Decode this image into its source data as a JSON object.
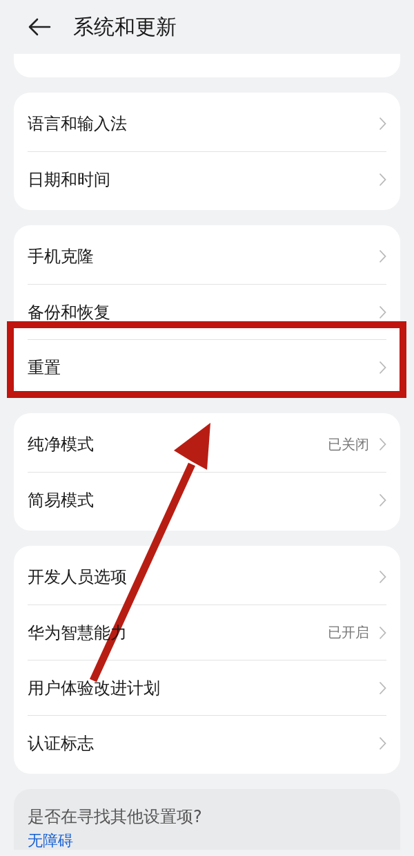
{
  "header": {
    "title": "系统和更新"
  },
  "groups": [
    {
      "items": [
        {
          "label": "语言和输入法",
          "highlighted": false
        },
        {
          "label": "日期和时间",
          "highlighted": false
        }
      ]
    },
    {
      "items": [
        {
          "label": "手机克隆",
          "highlighted": false
        },
        {
          "label": "备份和恢复",
          "highlighted": false
        },
        {
          "label": "重置",
          "highlighted": true
        }
      ]
    },
    {
      "items": [
        {
          "label": "纯净模式",
          "value": "已关闭",
          "highlighted": false
        },
        {
          "label": "简易模式",
          "highlighted": false
        }
      ]
    },
    {
      "items": [
        {
          "label": "开发人员选项",
          "highlighted": false
        },
        {
          "label": "华为智慧能力",
          "value": "已开启",
          "highlighted": false
        },
        {
          "label": "用户体验改进计划",
          "highlighted": false
        },
        {
          "label": "认证标志",
          "highlighted": false
        }
      ]
    }
  ],
  "suggestion": {
    "question": "是否在寻找其他设置项?",
    "link": "无障碍"
  }
}
